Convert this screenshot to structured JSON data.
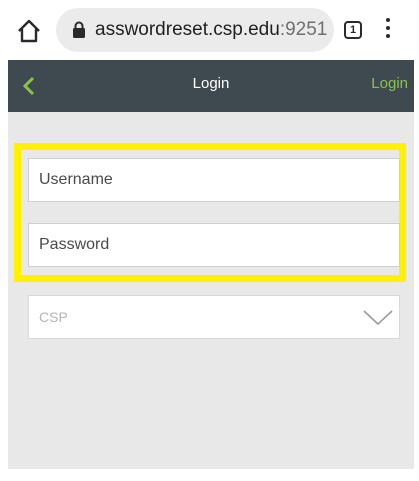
{
  "browser": {
    "url_host": "asswordreset.csp.edu",
    "url_port": ":9251",
    "tab_count": "1",
    "icons": {
      "home": "home-icon",
      "lock": "lock-icon",
      "menu": "more-vert-icon"
    }
  },
  "header": {
    "title": "Login",
    "action_label": "Login",
    "colors": {
      "bar": "#3f4a50",
      "accent": "#8bc34a"
    },
    "back_icon": "chevron-left-icon"
  },
  "form": {
    "username_placeholder": "Username",
    "password_placeholder": "Password",
    "domain_select": {
      "value": "CSP",
      "icon": "chevron-down-icon"
    },
    "highlight_color": "#fff200"
  }
}
